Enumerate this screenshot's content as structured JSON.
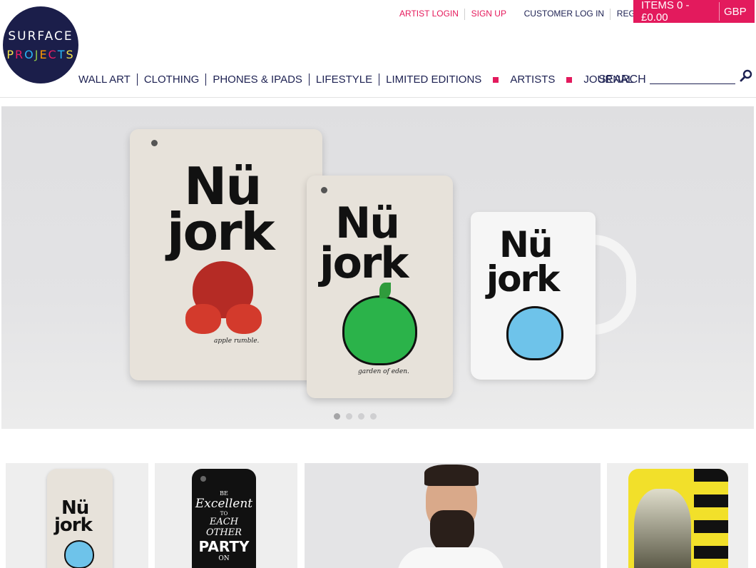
{
  "brand": {
    "line1": "SURFACE",
    "line2_letters": [
      "P",
      "R",
      "O",
      "J",
      "E",
      "C",
      "T",
      "S"
    ],
    "line2_colors": [
      "#f2e24b",
      "#e91e63",
      "#29b6f6",
      "#8bc34a",
      "#ff9800",
      "#e91e63",
      "#29b6f6",
      "#f2e24b"
    ]
  },
  "toplinks": {
    "artist_login": "ARTIST LOGIN",
    "sign_up": "SIGN UP",
    "customer_login": "CUSTOMER LOG IN",
    "register": "REGISTER"
  },
  "cart": {
    "items_label": "ITEMS 0 - £0.00",
    "currency": "GBP"
  },
  "nav": {
    "wall_art": "WALL ART",
    "clothing": "CLOTHING",
    "phones": "PHONES & IPADS",
    "lifestyle": "LIFESTYLE",
    "limited": "LIMITED EDITIONS",
    "artists": "ARTISTS",
    "journal": "JOURNAL"
  },
  "search": {
    "label": "SEARCH",
    "icon": "search-icon"
  },
  "hero": {
    "product_text_1": "Nü",
    "product_text_2": "jork",
    "caption_1": "apple rumble.",
    "caption_2": "garden of eden.",
    "slide_count": 4,
    "active_slide": 1
  },
  "tiles": {
    "tile2_lines": [
      "BE",
      "Excellent",
      "TO",
      "EACH OTHER",
      "PARTY",
      "ON"
    ]
  },
  "colors": {
    "accent": "#e31a5d",
    "navy": "#1d2152"
  }
}
